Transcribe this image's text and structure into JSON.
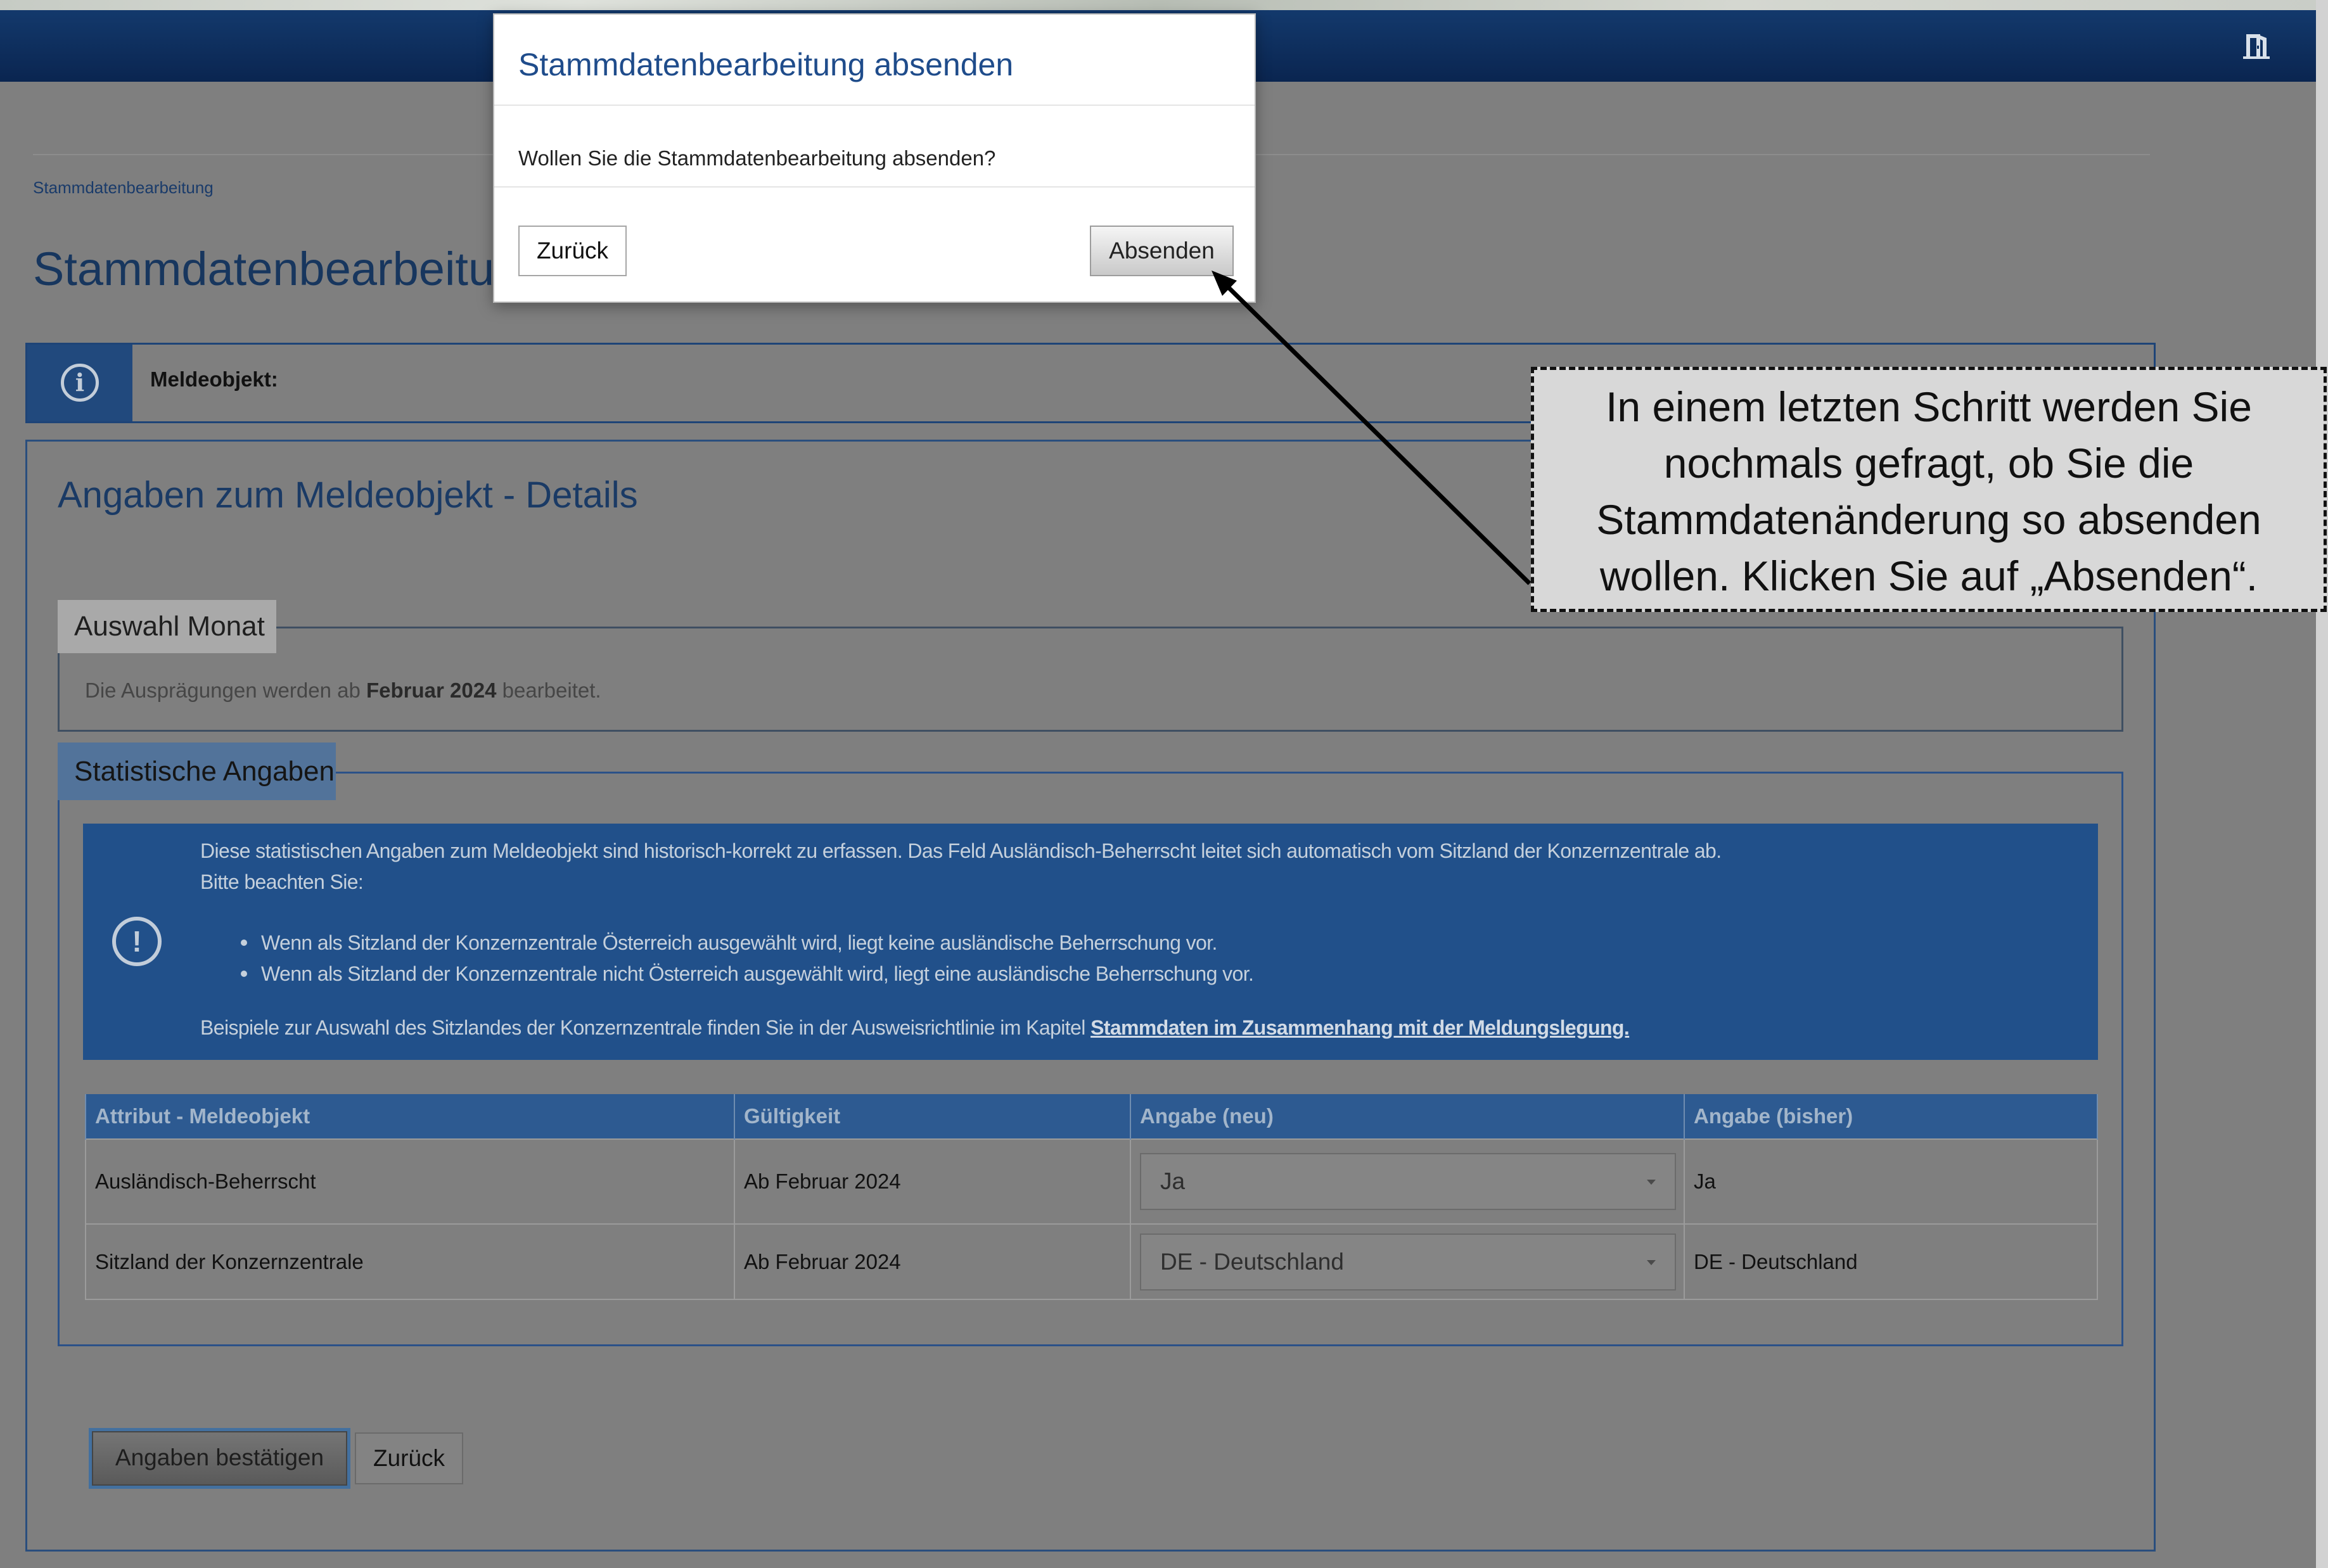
{
  "header": {
    "exit_icon": "exit-door-icon"
  },
  "breadcrumb": {
    "current": "Stammdatenbearbeitung"
  },
  "page": {
    "title": "Stammdatenbearbeitung"
  },
  "info_box": {
    "icon": "info-icon",
    "label": "Meldeobjekt:"
  },
  "details": {
    "title": "Angaben zum Meldeobjekt - Details",
    "month_section": {
      "legend": "Auswahl Monat",
      "text_before": "Die Ausprägungen werden ab ",
      "month": "Februar 2024",
      "text_after": " bearbeitet."
    },
    "stat_section": {
      "legend": "Statistische Angaben",
      "notice": {
        "icon": "alert-icon",
        "line1": "Diese statistischen Angaben zum Meldeobjekt sind historisch-korrekt zu erfassen. Das Feld Ausländisch-Beherrscht leitet sich automatisch vom Sitzland der Konzernzentrale ab.",
        "line2": "Bitte beachten Sie:",
        "bullets": [
          "Wenn als Sitzland der Konzernzentrale Österreich ausgewählt wird, liegt keine ausländische Beherrschung vor.",
          "Wenn als Sitzland der Konzernzentrale nicht Österreich ausgewählt wird, liegt eine ausländische Beherrschung vor."
        ],
        "footer_text": "Beispiele zur Auswahl des Sitzlandes der Konzernzentrale finden Sie in der Ausweisrichtlinie im Kapitel ",
        "footer_link": "Stammdaten im Zusammenhang mit der Meldungslegung."
      },
      "table": {
        "columns": [
          "Attribut - Meldeobjekt",
          "Gültigkeit",
          "Angabe (neu)",
          "Angabe (bisher)"
        ],
        "rows": [
          {
            "attribute": "Ausländisch-Beherrscht",
            "validity": "Ab Februar 2024",
            "new_value": "Ja",
            "old_value": "Ja"
          },
          {
            "attribute": "Sitzland der Konzernzentrale",
            "validity": "Ab Februar 2024",
            "new_value": "DE - Deutschland",
            "old_value": "DE - Deutschland"
          }
        ],
        "select_icon": "chevron-down-icon"
      }
    }
  },
  "actions": {
    "confirm_label": "Angaben bestätigen",
    "back_label": "Zurück"
  },
  "modal": {
    "title": "Stammdatenbearbeitung absenden",
    "message": "Wollen Sie die Stammdatenbearbeitung absenden?",
    "back_label": "Zurück",
    "submit_label": "Absenden"
  },
  "callout": {
    "lines": [
      "In einem letzten Schritt werden Sie",
      "nochmals gefragt, ob Sie die",
      "Stammdatenänderung so absenden",
      "wollen. Klicken Sie auf „Absenden“."
    ]
  },
  "colors": {
    "nav_bg": "#0e2f5e",
    "accent_blue": "#1f4c8b",
    "notice_bg": "#21508a",
    "table_header_bg": "#2d5a91",
    "callout_bg": "#d8d8d8"
  }
}
